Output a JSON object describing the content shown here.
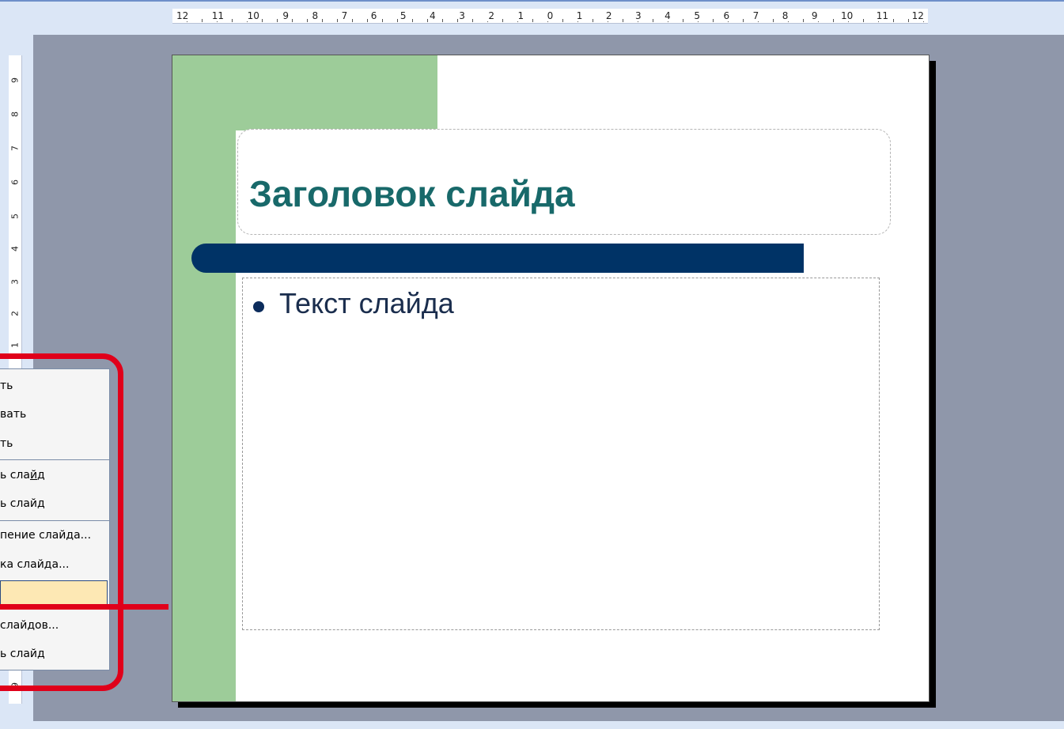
{
  "ruler": {
    "horizontal": [
      "12",
      "11",
      "10",
      "9",
      "8",
      "7",
      "6",
      "5",
      "4",
      "3",
      "2",
      "1",
      "0",
      "1",
      "2",
      "3",
      "4",
      "5",
      "6",
      "7",
      "8",
      "9",
      "10",
      "11",
      "12"
    ],
    "vertical": [
      "9",
      "8",
      "7",
      "6",
      "5",
      "4",
      "3",
      "2",
      "1",
      "9"
    ]
  },
  "slide": {
    "title": "Заголовок слайда",
    "body_text": "Текст слайда"
  },
  "context_menu": {
    "items": [
      {
        "label": "ть"
      },
      {
        "label": "вать"
      },
      {
        "label": "ть"
      },
      {
        "label": "ь слайд",
        "underline": "й"
      },
      {
        "label": "ь слайд"
      },
      {
        "label": "пение слайда..."
      },
      {
        "label": "ка слайда..."
      },
      {
        "label": "",
        "highlighted": true
      },
      {
        "label": "слайдов..."
      },
      {
        "label": "ь слайд"
      }
    ]
  },
  "colors": {
    "accent_green": "#9dcc99",
    "bar_navy": "#003366",
    "title_teal": "#18696a",
    "annotation_red": "#e0001a",
    "menu_highlight": "#fde8b4"
  }
}
